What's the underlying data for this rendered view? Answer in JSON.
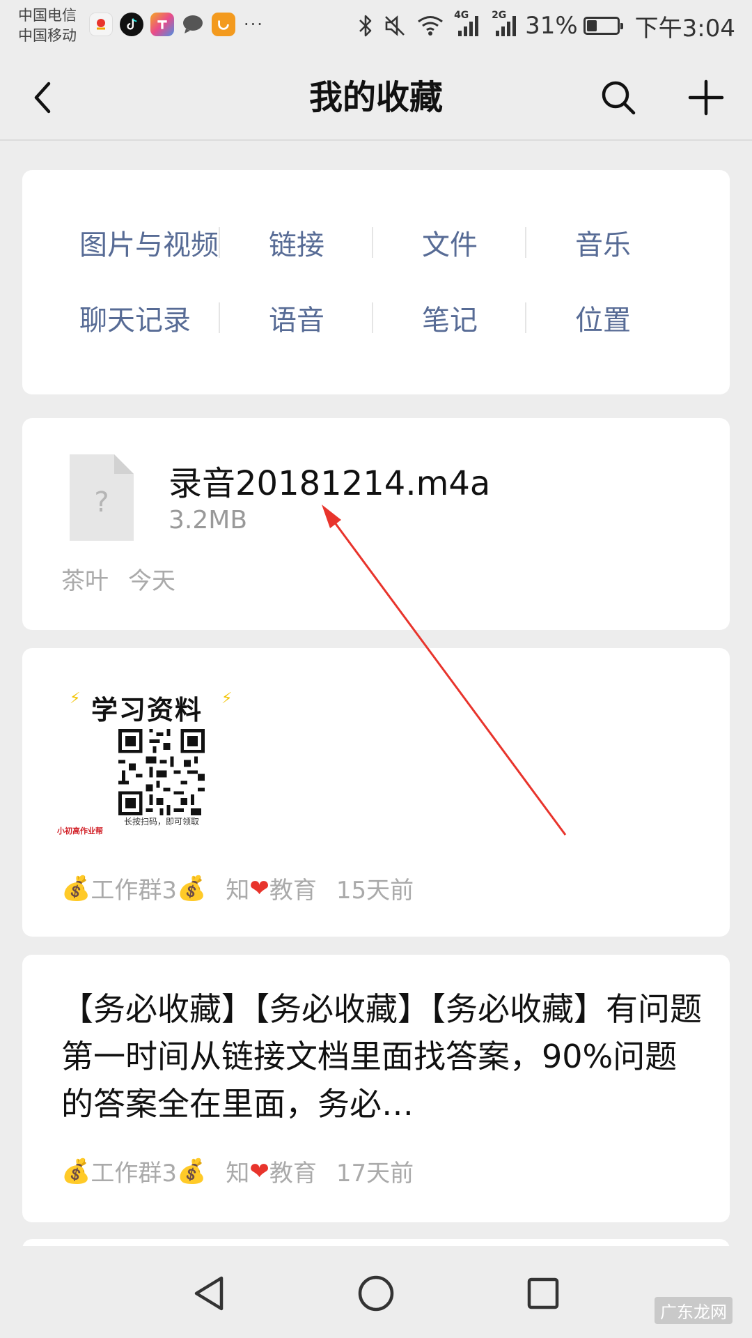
{
  "status_bar": {
    "carrier_1": "中国电信",
    "carrier_2": "中国移动",
    "more": "···",
    "net_4g": "4G",
    "net_2g": "2G",
    "battery": "31%",
    "battery_level": 0.31,
    "time": "下午3:04"
  },
  "nav": {
    "title": "我的收藏"
  },
  "categories": [
    {
      "label": "图片与视频"
    },
    {
      "label": "链接"
    },
    {
      "label": "文件"
    },
    {
      "label": "音乐"
    },
    {
      "label": "聊天记录"
    },
    {
      "label": "语音"
    },
    {
      "label": "笔记"
    },
    {
      "label": "位置"
    }
  ],
  "items": {
    "file": {
      "name": "录音20181214.m4a",
      "size": "3.2MB",
      "icon_glyph": "?",
      "source": "茶叶",
      "time": "今天"
    },
    "image": {
      "poster_title": "学习资料",
      "poster_hint": "长按扫码，即可领取",
      "poster_brand": "小初高作业帮",
      "source_prefix": "工作群3",
      "source_name_a": "知",
      "source_name_b": "教育",
      "time": "15天前"
    },
    "text": {
      "body": "【务必收藏】【务必收藏】【务必收藏】有问题第一时间从链接文档里面找答案，90%问题的答案全在里面，务必…",
      "source_prefix": "工作群3",
      "source_name_a": "知",
      "source_name_b": "教育",
      "time": "17天前"
    }
  },
  "watermark": "广东龙网",
  "colors": {
    "background": "#ededed",
    "link_blue": "#576b95",
    "meta_gray": "#aaaaaa",
    "annotation_red": "#e8342c"
  }
}
